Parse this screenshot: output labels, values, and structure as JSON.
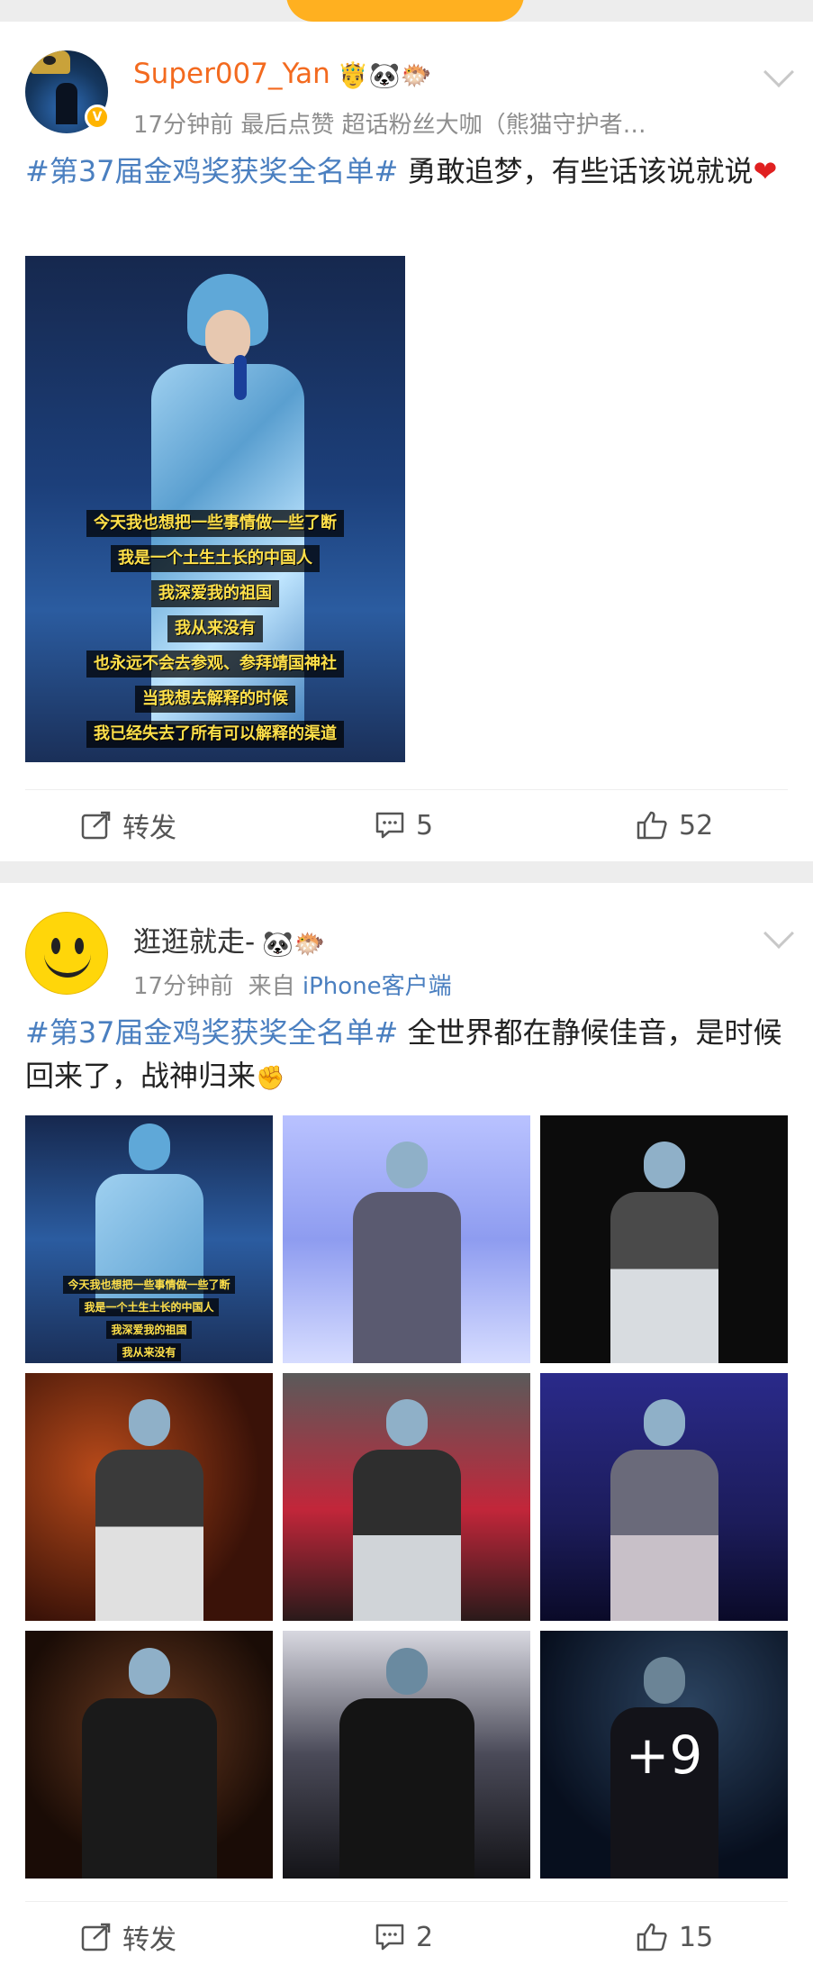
{
  "posts": [
    {
      "username": "Super007_Yan",
      "badges": "🤴🐼🐡",
      "verified_mark": "V",
      "meta": "17分钟前  最后点赞  超话粉丝大咖（熊猫守护者…",
      "hashtag": "#第37届金鸡奖获奖全名单#",
      "text": " 勇敢追梦，有些话该说就说",
      "emoji": "❤",
      "image_subtitles": [
        "今天我也想把一些事情做一些了断",
        "我是一个土生土长的中国人",
        "我深爱我的祖国",
        "我从来没有",
        "也永远不会去参观、参拜靖国神社",
        "当我想去解释的时候",
        "我已经失去了所有可以解释的渠道"
      ],
      "actions": {
        "repost": "转发",
        "comments": "5",
        "likes": "52"
      }
    },
    {
      "username": "逛逛就走-",
      "badges": "🐼🐡",
      "meta_time": "17分钟前",
      "meta_from": "来自",
      "meta_source": "iPhone客户端",
      "hashtag": "#第37届金鸡奖获奖全名单#",
      "text": " 全世界都在静候佳音，是时候回来了，战神归来",
      "emoji": "✊",
      "grid_subtitles": [
        "今天我也想把一些事情做一些了断",
        "我是一个土生土长的中国人",
        "我深爱我的祖国",
        "我从来没有"
      ],
      "more_count": "+9",
      "actions": {
        "repost": "转发",
        "comments": "2",
        "likes": "15"
      }
    }
  ],
  "colors": {
    "accent": "#4a7fc0",
    "username_orange": "#f36a1f",
    "banner": "#ffb020"
  },
  "icons": {
    "repost": "share-icon",
    "comment": "comment-icon",
    "like": "thumbs-up-icon",
    "menu": "chevron-down-icon"
  }
}
